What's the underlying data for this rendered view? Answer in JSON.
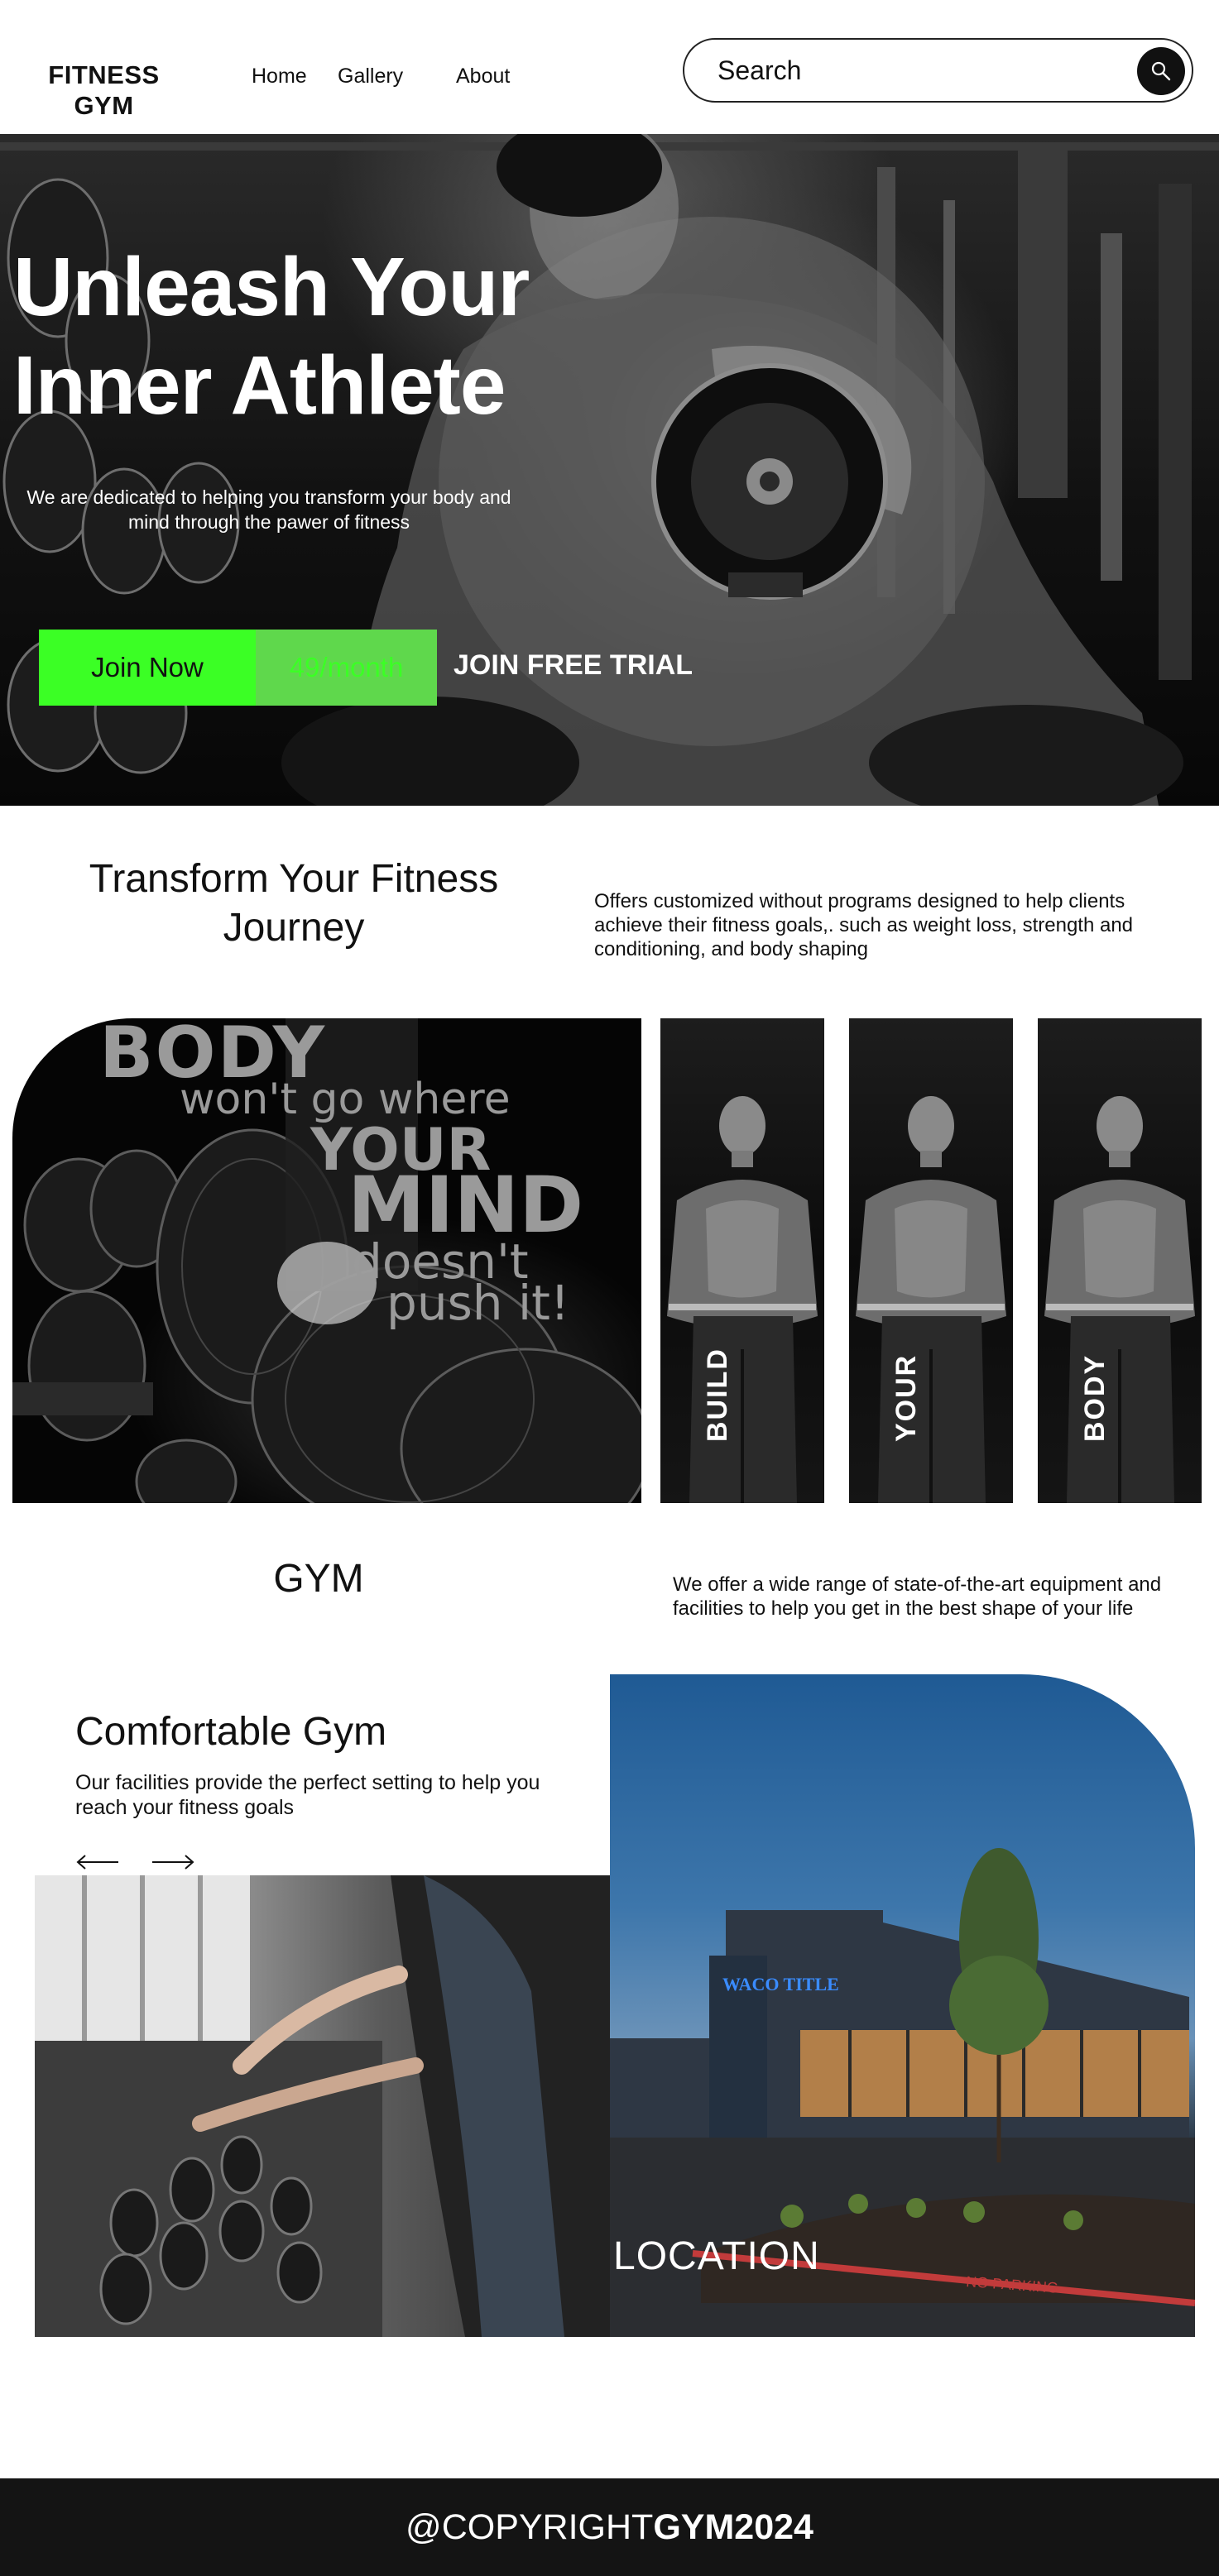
{
  "header": {
    "logo": "FITNESS GYM",
    "nav": [
      "Home",
      "Gallery",
      "About"
    ],
    "search_placeholder": "Search"
  },
  "hero": {
    "title": "Unleash Your Inner Athlete",
    "subtitle": "We are dedicated  to helping you transform your body and mind through the pawer of fitness",
    "join_label": "Join Now",
    "price": "49/month",
    "trial_label": "JOIN FREE TRIAL"
  },
  "transform": {
    "title": "Transform Your Fitness Journey",
    "description": "Offers customized without programs designed to help clients achieve their fitness goals,. such as weight loss, strength and conditioning, and body shaping"
  },
  "gallery": {
    "quote": [
      "BODY",
      "won't go where",
      "YOUR",
      "MIND",
      "doesn't",
      "push it!"
    ],
    "panels": [
      "BUILD",
      "YOUR",
      "BODY"
    ]
  },
  "gym": {
    "title": "GYM",
    "description": "We offer a wide range of state-of-the-art equipment and facilities to help you get in the best shape of your life"
  },
  "comfortable": {
    "title": "Comfortable Gym",
    "description": "Our facilities provide the perfect setting to help you reach your fitness goals",
    "location_label": "LOCATION",
    "sign_text": "WACO TITLE",
    "curb_text": "NO PARKING"
  },
  "footer": {
    "copyright_prefix": "@COPYRIGHT",
    "copyright_brand": "GYM2024"
  },
  "colors": {
    "accent_green": "#3bff25",
    "price_green": "#5fd84c",
    "footer_bg": "#141414"
  },
  "icons": [
    "search-icon",
    "arrow-left-icon",
    "arrow-right-icon"
  ]
}
